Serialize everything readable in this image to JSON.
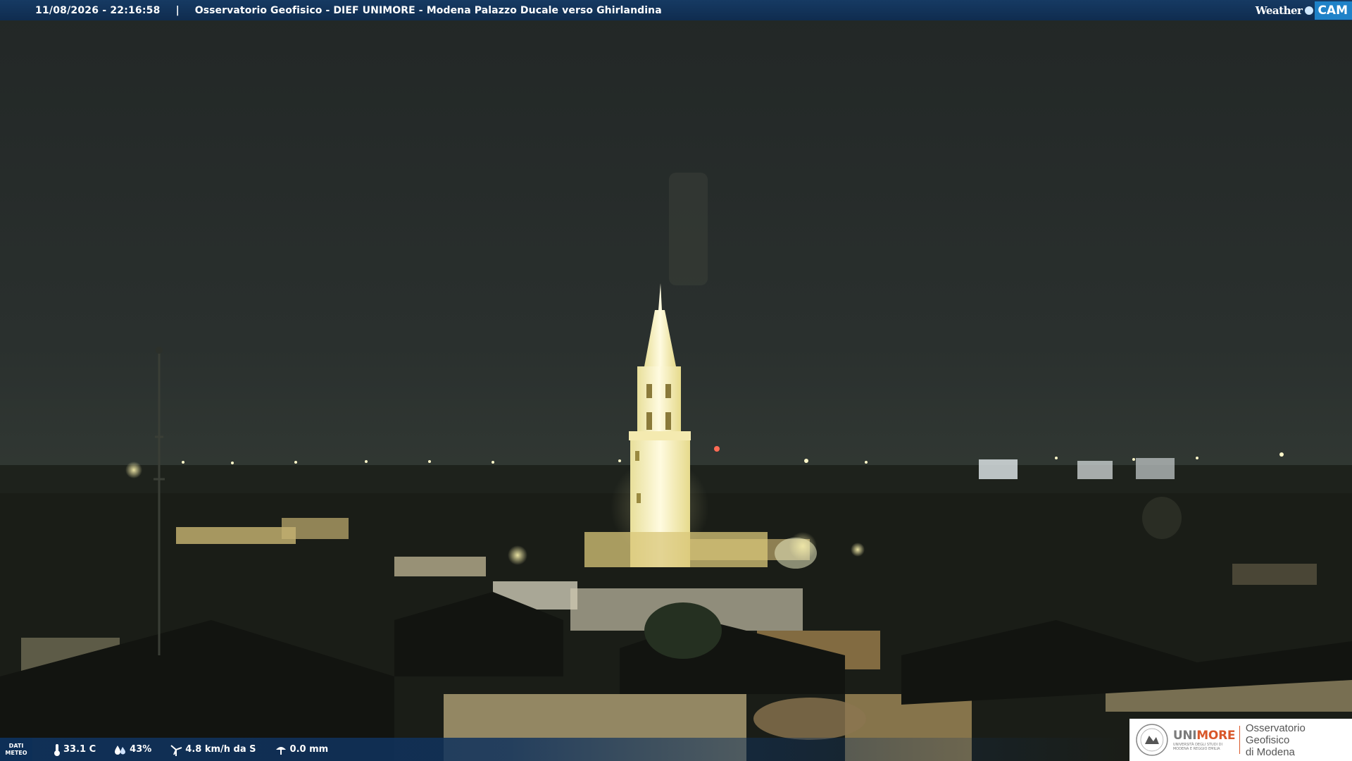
{
  "header": {
    "timestamp": "11/08/2026 - 22:16:58",
    "separator": "|",
    "title": "Osservatorio Geofisico - DIEF UNIMORE - Modena Palazzo Ducale verso Ghirlandina",
    "brand_weather": "Weather",
    "brand_cam": "CAM"
  },
  "weather_bar": {
    "dati_line1": "DATI",
    "dati_line2": "METEO",
    "temperature": "33.1 C",
    "humidity": "43%",
    "wind": "4.8 km/h da S",
    "rain": "0.0 mm"
  },
  "logo": {
    "uni_prefix": "UNI",
    "uni_suffix": "MORE",
    "uni_sub": "Università degli studi di Modena e Reggio Emilia",
    "obs_line1": "Osservatorio Geofisico",
    "obs_line2": "di Modena"
  },
  "icons": [
    "thermometer-icon",
    "humidity-drop-icon",
    "wind-turbine-icon",
    "rain-gauge-icon",
    "university-seal-icon"
  ],
  "colors": {
    "header_bar": "#13355d",
    "cam_badge": "#1f82c8",
    "unimore_accent": "#d9582a",
    "sky": "#262b29",
    "tower_light": "#f7f0b8"
  }
}
